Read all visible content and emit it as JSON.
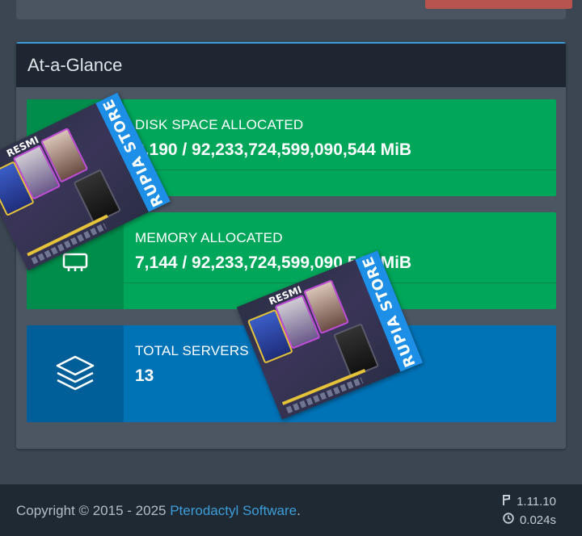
{
  "colors": {
    "page_background": "#3b4652",
    "header_background": "#1e2731",
    "accent": "#3c9dd8",
    "success_green": "#00a65a",
    "info_blue": "#0073b7",
    "danger_red": "#b85450"
  },
  "glance": {
    "title": "At-a-Glance"
  },
  "info_boxes": [
    {
      "label": "DISK SPACE ALLOCATED",
      "value": "8,190 / 92,233,724,599,090,544 MiB",
      "icon": "hdd-icon",
      "color": "#00a65a"
    },
    {
      "label": "MEMORY ALLOCATED",
      "value": "7,144 / 92,233,724,599,090,544 MiB",
      "icon": "memory-icon",
      "color": "#00a65a"
    },
    {
      "label": "TOTAL SERVERS",
      "value": "13",
      "icon": "stack-layers-icon",
      "color": "#0073b7"
    }
  ],
  "footer": {
    "copyright_prefix": "Copyright © 2015 - 2025 ",
    "copyright_link": "Pterodactyl Software",
    "copyright_suffix": ".",
    "version": "1.11.10",
    "version_icon": "code-branch-icon",
    "render_time": "0.024s",
    "render_time_icon": "clock-icon"
  },
  "promo_overlay": {
    "banner_text": "RUPIA STORE",
    "title": "RESMI"
  }
}
